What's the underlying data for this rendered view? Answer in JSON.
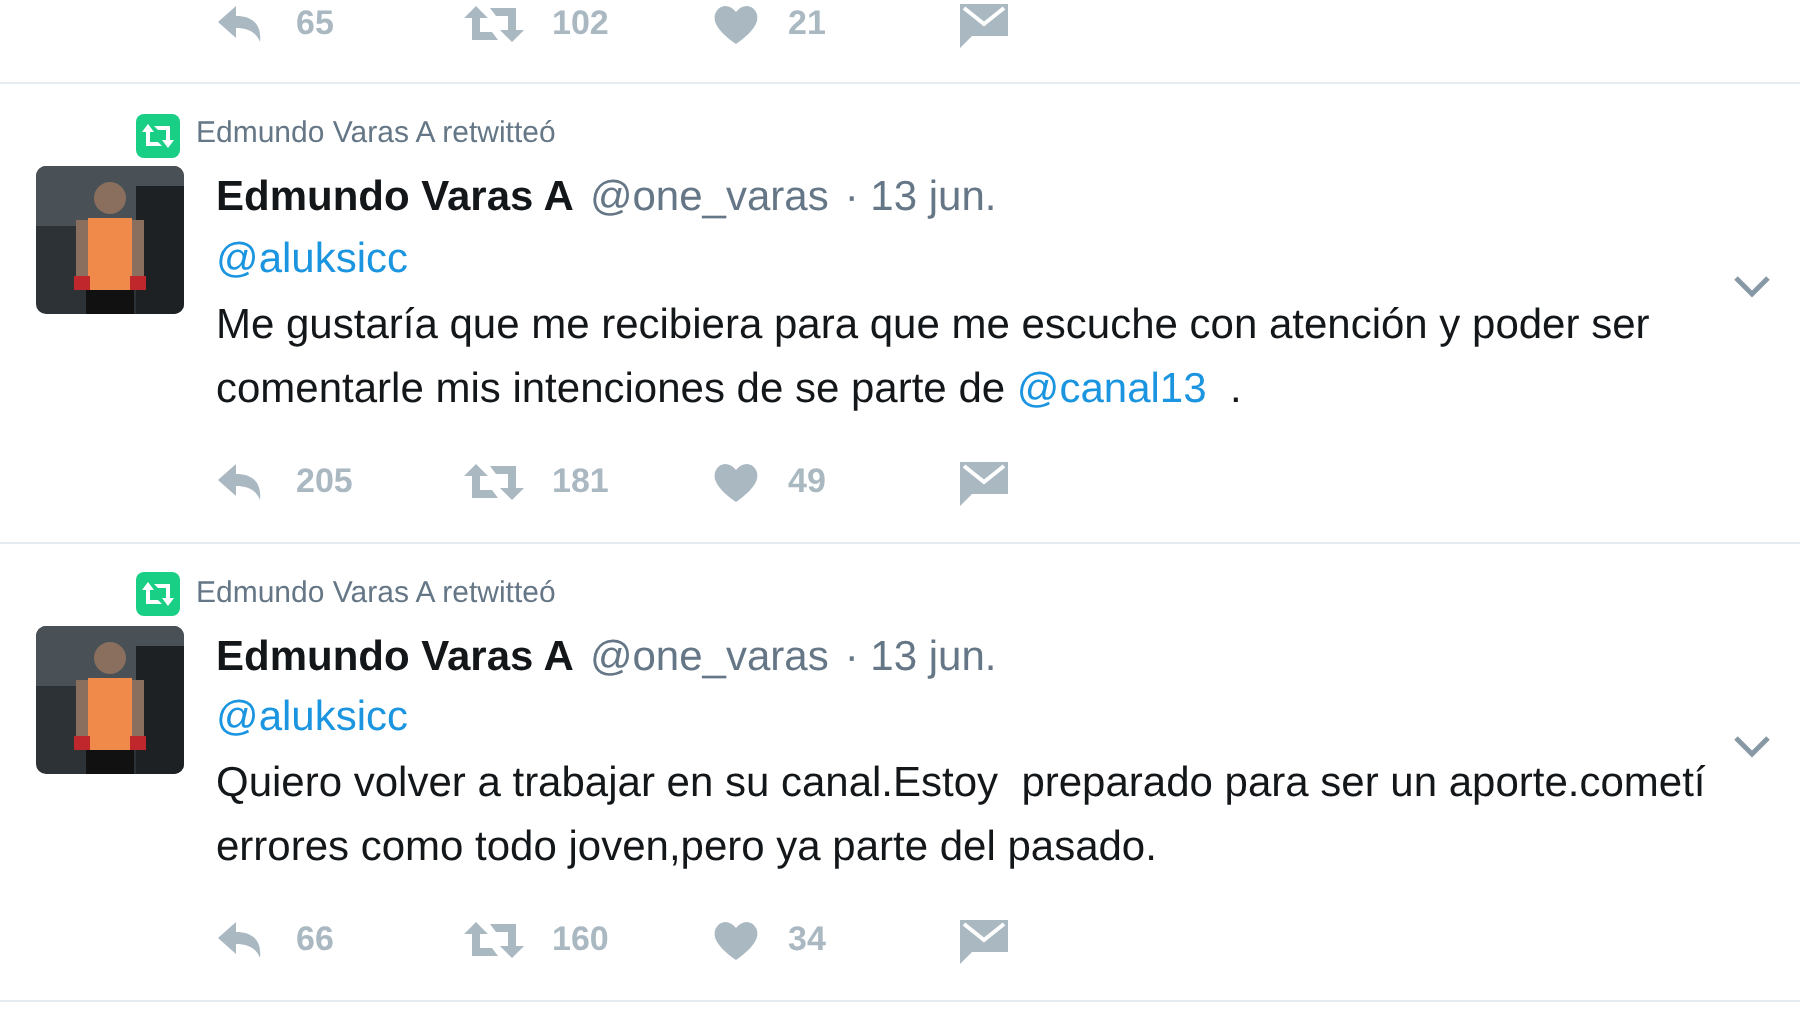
{
  "top_actions": {
    "replies": "65",
    "retweets": "102",
    "likes": "21"
  },
  "tweets": [
    {
      "retweeted_by": "Edmundo Varas A retwitteó",
      "name": "Edmundo Varas A",
      "handle": "@one_varas",
      "date": "· 13 jun.",
      "reply_to": "@aluksicc",
      "body": [
        {
          "kind": "text",
          "text": "Me gustaría que me recibiera para que me escuche con atención y poder ser comentarle mis intenciones de se parte de "
        },
        {
          "kind": "mention",
          "text": "@canal13"
        },
        {
          "kind": "text",
          "text": "  ."
        }
      ],
      "replies": "205",
      "retweets": "181",
      "likes": "49"
    },
    {
      "retweeted_by": "Edmundo Varas A retwitteó",
      "name": "Edmundo Varas A",
      "handle": "@one_varas",
      "date": "· 13 jun.",
      "reply_to": "@aluksicc",
      "body": [
        {
          "kind": "text",
          "text": "Quiero volver a trabajar en su canal.Estoy  preparado para ser un aporte.cometí errores como todo joven,pero ya parte del pasado."
        }
      ],
      "replies": "66",
      "retweets": "160",
      "likes": "34"
    }
  ]
}
